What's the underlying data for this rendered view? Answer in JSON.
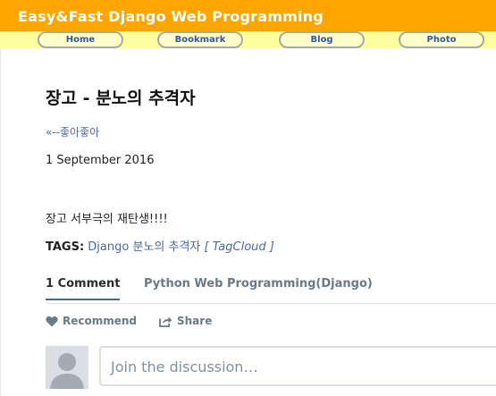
{
  "site": {
    "title": "Easy&Fast Django Web Programming"
  },
  "nav": {
    "items": [
      {
        "label": "Home"
      },
      {
        "label": "Bookmark"
      },
      {
        "label": "Blog"
      },
      {
        "label": "Photo"
      }
    ]
  },
  "post": {
    "title": "장고 - 분노의 추격자",
    "prev_link": "«--좋아좋아",
    "date": "1 September 2016",
    "body": "장고 서부극의 재탄생!!!!",
    "tags_label": "TAGS:",
    "tags": [
      "Django",
      "분노의 추격자"
    ],
    "tag_cloud": "[ TagCloud ]"
  },
  "comments": {
    "tab_count_label": "1 Comment",
    "tab_forum_label": "Python Web Programming(Django)",
    "recommend_label": "Recommend",
    "share_label": "Share",
    "reply_placeholder": "Join the discussion…"
  },
  "colors": {
    "header_bg": "#ffa500",
    "nav_bg": "#ffffa0",
    "link": "#4a6a9e"
  }
}
